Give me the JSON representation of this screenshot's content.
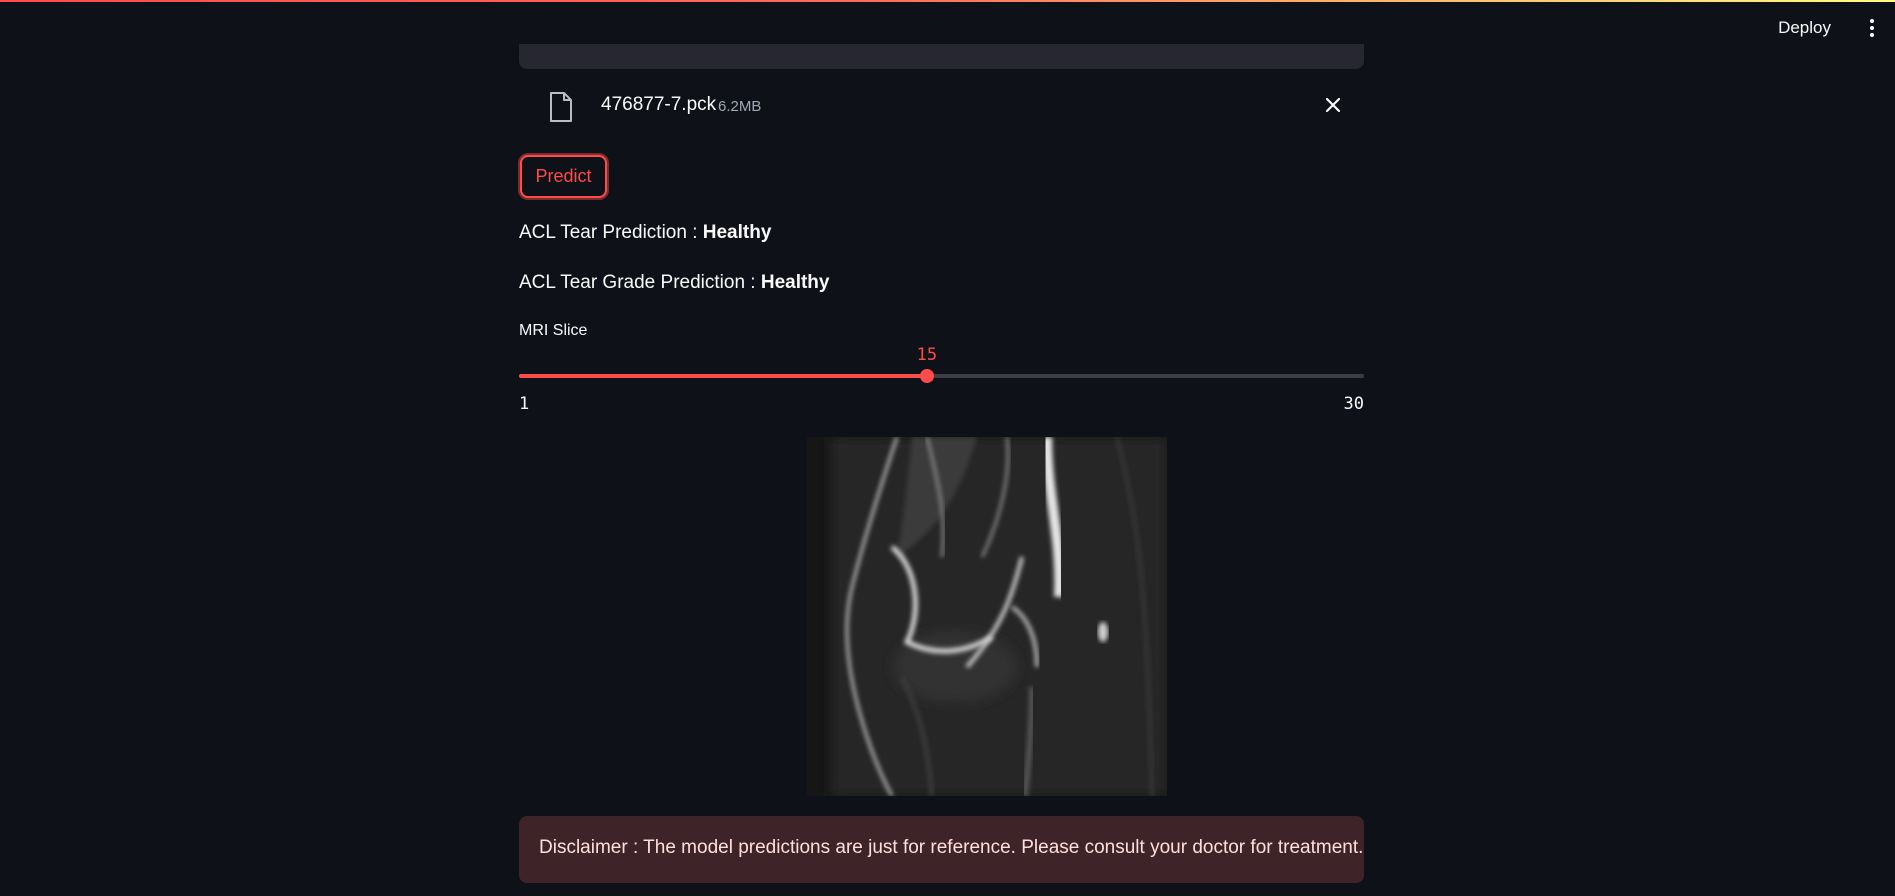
{
  "header": {
    "deploy_label": "Deploy",
    "menu_icon": "kebab-vertical-icon"
  },
  "uploader": {
    "file_icon": "file-icon",
    "file_name": "476877-7.pck",
    "file_size": "6.2MB",
    "remove_icon": "close-icon"
  },
  "actions": {
    "predict_label": "Predict"
  },
  "results": {
    "acl_label": "ACL Tear Prediction : ",
    "acl_value": "Healthy",
    "grade_label": "ACL Tear Grade Prediction : ",
    "grade_value": "Healthy"
  },
  "slider": {
    "label": "MRI Slice",
    "value": 15,
    "min": 1,
    "max": 30
  },
  "disclaimer": {
    "text": "Disclaimer : The model predictions are just for reference. Please consult your doctor for treatment."
  },
  "colors": {
    "background": "#0e1117",
    "accent": "#ff4b4b",
    "track": "#3a3d48",
    "disclaimer_bg": "#3e2328",
    "disclaimer_text": "#ffdede"
  }
}
